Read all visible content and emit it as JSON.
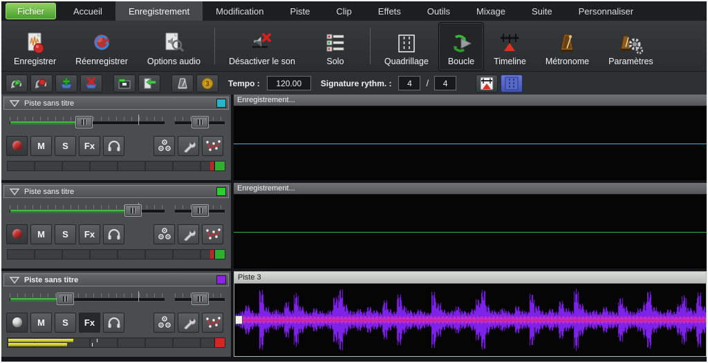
{
  "menubar": {
    "items": [
      {
        "label": "Fichier",
        "variant": "file"
      },
      {
        "label": "Accueil"
      },
      {
        "label": "Enregistrement",
        "selected": true
      },
      {
        "label": "Modification"
      },
      {
        "label": "Piste"
      },
      {
        "label": "Clip"
      },
      {
        "label": "Effets"
      },
      {
        "label": "Outils"
      },
      {
        "label": "Mixage"
      },
      {
        "label": "Suite"
      },
      {
        "label": "Personnaliser"
      }
    ]
  },
  "toolbar": {
    "buttons": [
      {
        "label": "Enregistrer",
        "icon": "record-document-icon"
      },
      {
        "label": "Réenregistrer",
        "icon": "rerecord-icon"
      },
      {
        "label": "Options audio",
        "icon": "audio-options-icon"
      },
      {
        "label": "Désactiver le son",
        "icon": "mute-speaker-icon"
      },
      {
        "label": "Solo",
        "icon": "solo-tracks-icon"
      },
      {
        "label": "Quadrillage",
        "icon": "grid-icon"
      },
      {
        "label": "Boucle",
        "icon": "loop-icon",
        "selected": true
      },
      {
        "label": "Timeline",
        "icon": "timeline-icon"
      },
      {
        "label": "Métronome",
        "icon": "metronome-icon"
      },
      {
        "label": "Paramètres",
        "icon": "settings-icon"
      }
    ]
  },
  "transport": {
    "buttons": [
      "loop-play-icon",
      "loop-record-icon",
      "add-track-icon",
      "delete-track-icon",
      "open-project-icon",
      "import-file-icon",
      "metronome-toggle-icon",
      "sync-coin-icon"
    ],
    "tempo_label": "Tempo :",
    "tempo_value": "120.00",
    "signature_label": "Signature rythm. :",
    "signature_numerator": "4",
    "signature_separator": "/",
    "signature_denominator": "4",
    "toggles": [
      "timeline-toggle-icon",
      "grid-toggle-icon"
    ],
    "grid_toggle_active": true
  },
  "track_controls": {
    "mute": "M",
    "solo": "S",
    "fx": "Fx"
  },
  "tracks": [
    {
      "name": "Piste sans titre",
      "color": "#27b4c8",
      "volume_percent": 48,
      "pan_percent": 52,
      "record_armed": true,
      "fx_active": false,
      "meter": {
        "style": "idle",
        "cap_color": "#2fae2f"
      }
    },
    {
      "name": "Piste sans titre",
      "color": "#2ecc2e",
      "volume_percent": 80,
      "pan_percent": 52,
      "record_armed": true,
      "fx_active": false,
      "meter": {
        "style": "idle",
        "cap_color": "#2fae2f"
      }
    },
    {
      "name": "Piste sans titre",
      "color": "#8a25e0",
      "volume_percent": 36,
      "pan_percent": 52,
      "record_armed": false,
      "fx_active": true,
      "selected": true,
      "meter": {
        "style": "active",
        "left_percent": 30,
        "right_percent": 27,
        "tick_percent": 41,
        "cap_color": "#dd2222"
      }
    }
  ],
  "clips": [
    {
      "label": "Enregistrement...",
      "state": "recording",
      "line_color": "#3fc0cf"
    },
    {
      "label": "Enregistrement...",
      "state": "recording",
      "line_color": "#37b03c"
    },
    {
      "label": "Piste 3",
      "state": "selected",
      "waveform_color": "#7d22e8",
      "core_color": "#c92cc9",
      "center_line_color": "#cc2040",
      "waveform": [
        0.2,
        0.28,
        0.45,
        0.3,
        0.22,
        0.92,
        0.4,
        0.26,
        0.33,
        0.24,
        0.55,
        0.3,
        0.82,
        0.42,
        0.28,
        0.24,
        0.36,
        0.28,
        0.22,
        0.3,
        0.7,
        0.95,
        0.48,
        0.3,
        0.26,
        0.34,
        0.26,
        0.4,
        0.3,
        0.24,
        0.6,
        0.34,
        0.26,
        0.78,
        0.44,
        0.3,
        0.24,
        0.32,
        0.26,
        0.22,
        0.86,
        0.52,
        0.32,
        0.26,
        0.3,
        0.42,
        0.28,
        0.24,
        0.34,
        0.64,
        0.92,
        0.46,
        0.3,
        0.26,
        0.36,
        0.28,
        0.22,
        0.42,
        0.3,
        0.26,
        0.8,
        0.44,
        0.3,
        0.24,
        0.34,
        0.26,
        0.58,
        0.36,
        0.28,
        0.95,
        0.5,
        0.32,
        0.26,
        0.3,
        0.24,
        0.4,
        0.28,
        0.24,
        0.68,
        0.42,
        0.28,
        0.24,
        0.36,
        0.55,
        0.88,
        0.4,
        0.28,
        0.24,
        0.32,
        0.26,
        0.48,
        0.76,
        0.38,
        0.3,
        0.84,
        0.42
      ]
    }
  ]
}
